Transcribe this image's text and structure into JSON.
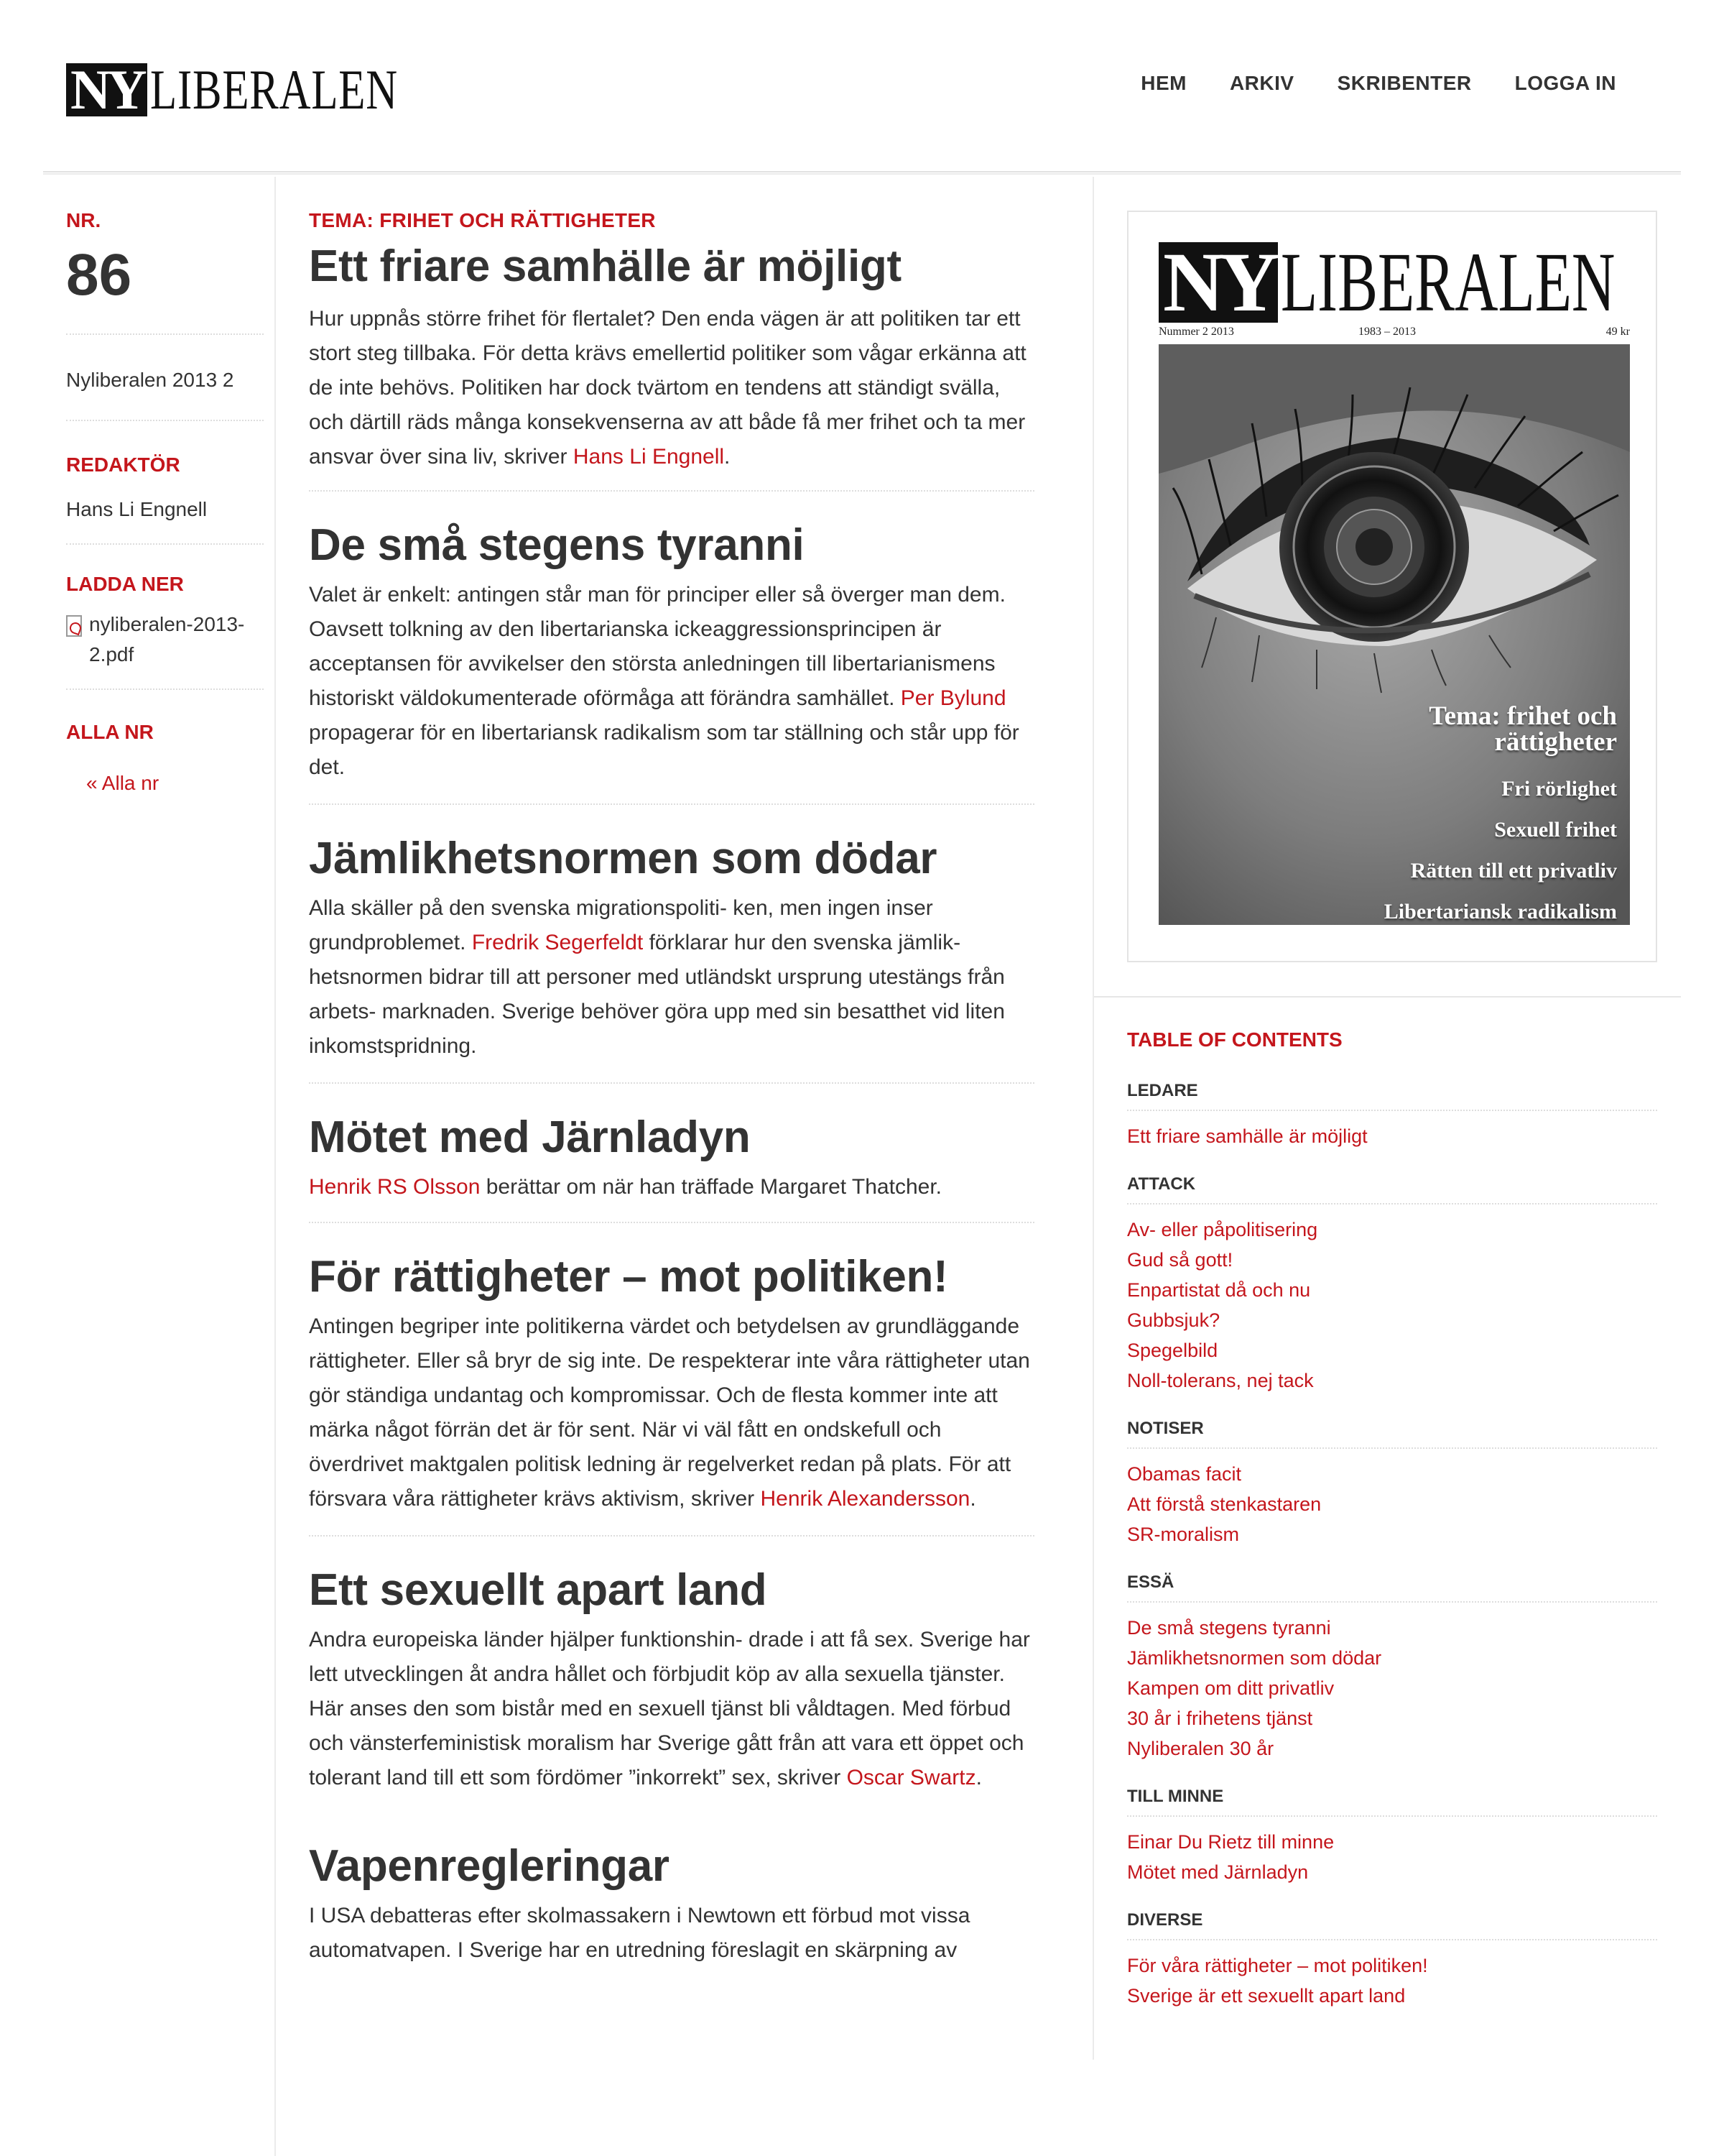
{
  "header": {
    "logo_ny": "NY",
    "logo_rest": "LIBERALEN",
    "nav": [
      "HEM",
      "ARKIV",
      "SKRIBENTER",
      "LOGGA IN"
    ]
  },
  "left": {
    "nr_label": "NR.",
    "nr_value": "86",
    "issue_name": "Nyliberalen 2013 2",
    "editor_label": "REDAKTÖR",
    "editor_name": "Hans Li Engnell",
    "download_label": "LADDA NER",
    "download_file": "nyliberalen-2013-2.pdf",
    "all_label": "ALLA NR",
    "all_link": "« Alla nr"
  },
  "main": {
    "theme": "TEMA: FRIHET OCH RÄTTIGHETER",
    "articles": [
      {
        "title": "Ett friare samhälle är möjligt",
        "text": "Hur uppnås större frihet för flertalet? Den enda vägen är att politiken tar ett stort steg tillbaka. För detta krävs emellertid politiker som vågar erkänna att de inte behövs. Politiken har dock tvärtom en tendens att ständigt svälla, och därtill räds många konsekvenserna av att både få mer frihet och ta mer ansvar över sina liv, skriver ",
        "author": "Hans Li Engnell",
        "tail": "."
      },
      {
        "title": "De små stegens tyranni",
        "text": "Valet är enkelt: antingen står man för principer eller så överger man dem. Oavsett tolkning av den libertarianska ickeaggressionsprincipen är acceptansen för avvikelser den största anledningen till libertarianismens historiskt väldokumenterade oförmåga att förändra samhället. ",
        "author": "Per Bylund",
        "tail": " propagerar för en libertariansk radikalism som tar ställning och står upp för det."
      },
      {
        "title": "Jämlikhetsnormen som dödar",
        "text": "Alla skäller på den svenska migrationspoliti- ken, men ingen inser grundproblemet. ",
        "author": "Fredrik Segerfeldt",
        "tail": " förklarar hur den svenska jämlik- hetsnormen bidrar till att personer med utländskt ursprung utestängs från arbets- marknaden. Sverige behöver göra upp med sin besatthet vid liten inkomstspridning."
      },
      {
        "title": "Mötet med Järnladyn",
        "text": "",
        "author": "Henrik RS Olsson",
        "tail": " berättar om när han träffade Margaret Thatcher."
      },
      {
        "title": "För rättigheter – mot politiken!",
        "text": "Antingen begriper inte politikerna värdet och betydelsen av grundläggande rättigheter. Eller så bryr de sig inte. De respekterar inte våra rättigheter utan gör ständiga undantag och kompromissar. Och de flesta kommer inte att märka något förrän det är för sent. När vi väl fått en ondskefull och överdrivet maktgalen politisk ledning är regelverket redan på plats. För att försvara våra rättigheter krävs aktivism, skriver ",
        "author": "Henrik Alexandersson",
        "tail": "."
      },
      {
        "title": "Ett sexuellt apart land",
        "text": "Andra europeiska länder hjälper funktionshin- drade i att få sex. Sverige har lett utvecklingen åt andra hållet och förbjudit köp av alla sexuella tjänster. Här anses den som bistår med en sexuell tjänst bli våldtagen. Med förbud och vänsterfeministisk moralism har Sverige gått från att vara ett öppet och tolerant land till ett som fördömer ”inkorrekt” sex, skriver ",
        "author": "Oscar Swartz",
        "tail": "."
      },
      {
        "title": "Vapenregleringar",
        "text": "I USA debatteras efter skolmassakern i Newtown ett förbud mot vissa automatvapen. I Sverige har en utredning föreslagit en skärpning av",
        "author": "",
        "tail": ""
      }
    ]
  },
  "cover": {
    "logo_ny": "NY",
    "logo_rest": "LIBERALEN",
    "issue": "Nummer 2 2013",
    "years": "1983 – 2013",
    "price": "49 kr",
    "theme_line1": "Tema: frihet och",
    "theme_line2": "rättigheter",
    "items": [
      "Fri rörlighet",
      "Sexuell frihet",
      "Rätten till ett privatliv",
      "Libertariansk radikalism"
    ]
  },
  "toc": {
    "title": "TABLE OF CONTENTS",
    "sections": [
      {
        "name": "LEDARE",
        "links": [
          "Ett friare samhälle är möjligt"
        ]
      },
      {
        "name": "ATTACK",
        "links": [
          "Av- eller påpolitisering",
          "Gud så gott!",
          "Enpartistat då och nu",
          "Gubbsjuk?",
          "Spegelbild",
          "Noll-tolerans, nej tack"
        ]
      },
      {
        "name": "NOTISER",
        "links": [
          "Obamas facit",
          "Att förstå stenkastaren",
          "SR-moralism"
        ]
      },
      {
        "name": "ESSÄ",
        "links": [
          "De små stegens tyranni",
          "Jämlikhetsnormen som dödar",
          "Kampen om ditt privatliv",
          "30 år i frihetens tjänst",
          "Nyliberalen 30 år"
        ]
      },
      {
        "name": "TILL MINNE",
        "links": [
          "Einar Du Rietz till minne",
          "Mötet med Järnladyn"
        ]
      },
      {
        "name": "DIVERSE",
        "links": [
          "För våra rättigheter – mot politiken!",
          "Sverige är ett sexuellt apart land"
        ]
      }
    ]
  }
}
